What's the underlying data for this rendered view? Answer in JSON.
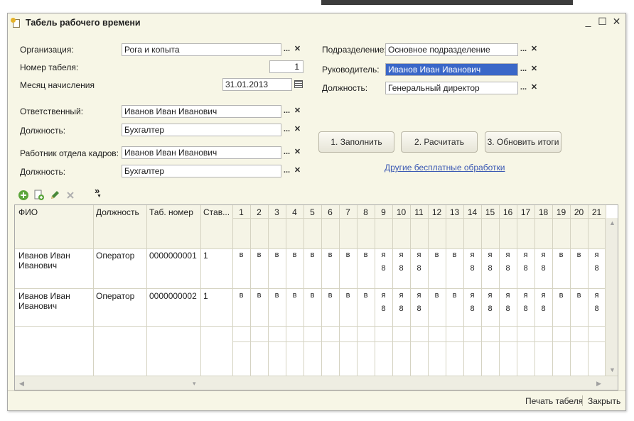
{
  "window": {
    "title": "Табель рабочего времени",
    "controls": {
      "minimize": "_",
      "maximize": "☐",
      "close": "✕"
    }
  },
  "form": {
    "organization": {
      "label": "Организация:",
      "value": "Рога и копыта"
    },
    "timesheet_number": {
      "label": "Номер табеля:",
      "value": "1"
    },
    "accrual_month": {
      "label": "Месяц начисления",
      "value": "31.01.2013"
    },
    "responsible": {
      "label": "Ответственный:",
      "value": "Иванов Иван Иванович"
    },
    "responsible_position": {
      "label": "Должность:",
      "value": "Бухгалтер"
    },
    "hr_employee": {
      "label": "Работник отдела кадров:",
      "value": "Иванов Иван Иванович"
    },
    "hr_position": {
      "label": "Должность:",
      "value": "Бухгалтер"
    },
    "department": {
      "label": "Подразделение:",
      "value": "Основное подразделение"
    },
    "manager": {
      "label": "Руководитель:",
      "value": "Иванов Иван Иванович"
    },
    "manager_position": {
      "label": "Должность:",
      "value": "Генеральный директор"
    },
    "select_glyph": "...",
    "clear_glyph": "✕"
  },
  "actions": {
    "fill": "1. Заполнить",
    "calculate": "2. Расчитать",
    "update_totals": "3. Обновить итоги",
    "link": "Другие бесплатные обработки"
  },
  "toolbar": {
    "more": "»"
  },
  "table": {
    "columns": {
      "fio": "ФИО",
      "position": "Должность",
      "tab_number": "Таб. номер",
      "rate": "Став..."
    },
    "days": [
      "1",
      "2",
      "3",
      "4",
      "5",
      "6",
      "7",
      "8",
      "9",
      "10",
      "11",
      "12",
      "13",
      "14",
      "15",
      "16",
      "17",
      "18",
      "19",
      "20",
      "21"
    ],
    "rows": [
      {
        "fio": "Иванов Иван Иванович",
        "position": "Оператор",
        "tab_number": "0000000001",
        "rate": "1",
        "codes": [
          "в",
          "в",
          "в",
          "в",
          "в",
          "в",
          "в",
          "в",
          "я",
          "я",
          "я",
          "в",
          "в",
          "я",
          "я",
          "я",
          "я",
          "я",
          "в",
          "в",
          "я"
        ],
        "hours": [
          "",
          "",
          "",
          "",
          "",
          "",
          "",
          "",
          "8",
          "8",
          "8",
          "",
          "",
          "8",
          "8",
          "8",
          "8",
          "8",
          "",
          "",
          "8"
        ]
      },
      {
        "fio": "Иванов Иван Иванович",
        "position": "Оператор",
        "tab_number": "0000000002",
        "rate": "1",
        "codes": [
          "в",
          "в",
          "в",
          "в",
          "в",
          "в",
          "в",
          "в",
          "я",
          "я",
          "я",
          "в",
          "в",
          "я",
          "я",
          "я",
          "я",
          "я",
          "в",
          "в",
          "я"
        ],
        "hours": [
          "",
          "",
          "",
          "",
          "",
          "",
          "",
          "",
          "8",
          "8",
          "8",
          "",
          "",
          "8",
          "8",
          "8",
          "8",
          "8",
          "",
          "",
          "8"
        ]
      }
    ]
  },
  "footer": {
    "print": "Печать табеля",
    "close": "Закрыть"
  }
}
